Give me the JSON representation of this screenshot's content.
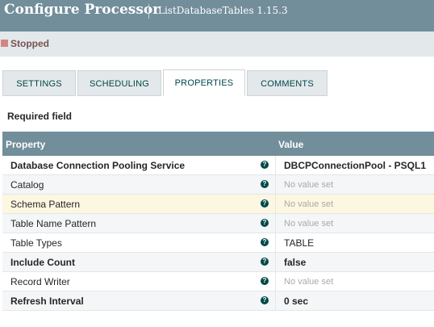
{
  "header": {
    "title": "Configure Processor",
    "subtitle": "ListDatabaseTables 1.15.3"
  },
  "status": {
    "label": "Stopped",
    "color": "#d18686"
  },
  "tabs": [
    {
      "label": "SETTINGS",
      "active": false
    },
    {
      "label": "SCHEDULING",
      "active": false
    },
    {
      "label": "PROPERTIES",
      "active": true
    },
    {
      "label": "COMMENTS",
      "active": false
    }
  ],
  "required_label": "Required field",
  "table": {
    "columns": [
      "Property",
      "Value"
    ],
    "rows": [
      {
        "name": "Database Connection Pooling Service",
        "required": true,
        "value": "DBCPConnectionPool - PSQL1",
        "value_set": true
      },
      {
        "name": "Catalog",
        "required": false,
        "value": "No value set",
        "value_set": false
      },
      {
        "name": "Schema Pattern",
        "required": false,
        "value": "No value set",
        "value_set": false
      },
      {
        "name": "Table Name Pattern",
        "required": false,
        "value": "No value set",
        "value_set": false
      },
      {
        "name": "Table Types",
        "required": false,
        "value": "TABLE",
        "value_set": true
      },
      {
        "name": "Include Count",
        "required": true,
        "value": "false",
        "value_set": true
      },
      {
        "name": "Record Writer",
        "required": false,
        "value": "No value set",
        "value_set": false
      },
      {
        "name": "Refresh Interval",
        "required": true,
        "value": "0 sec",
        "value_set": true
      }
    ]
  },
  "icons": {
    "help": "help-icon"
  },
  "colors": {
    "header": "#728e9b",
    "status_bar": "#e3e8eb",
    "accent": "#004849"
  }
}
